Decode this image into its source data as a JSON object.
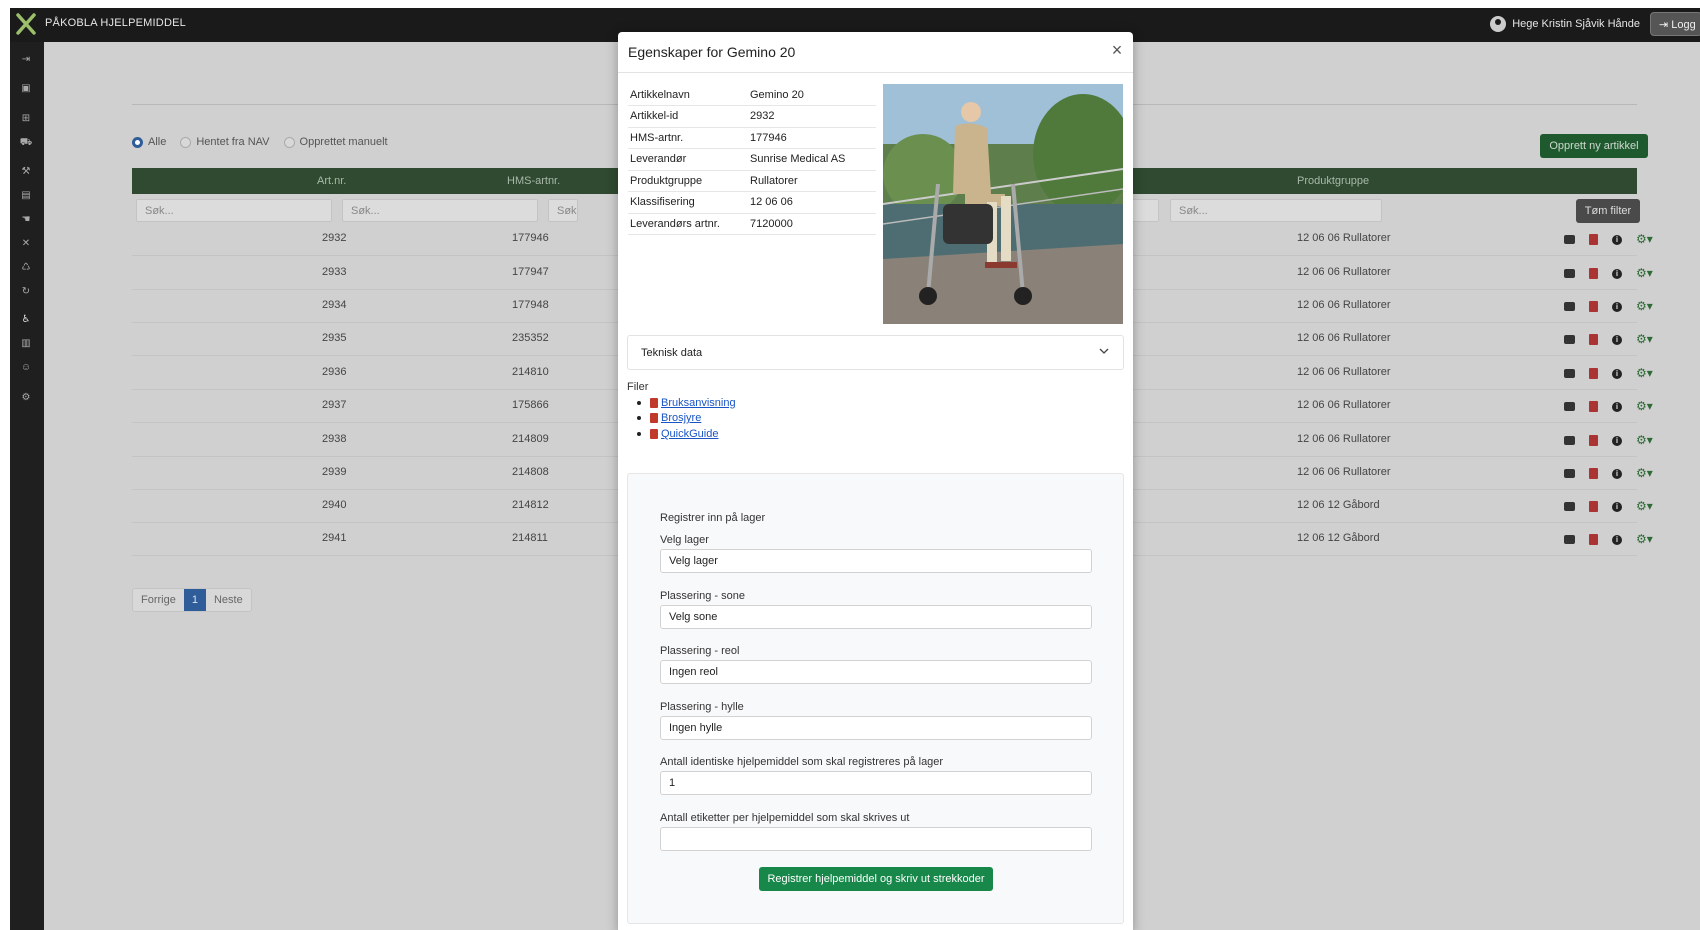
{
  "app": {
    "title": "PÅKOBLA HJELPEMIDDEL"
  },
  "user": {
    "name": "Hege Kristin Sjåvik Hånde",
    "logout_label": "Logg"
  },
  "filters": {
    "radio_options": [
      "Alle",
      "Hentet fra NAV",
      "Opprettet manuelt"
    ],
    "selected": "Alle",
    "search_placeholder": "Søk...",
    "partial_placeholder": "Søk",
    "clear_label": "Tøm filter"
  },
  "new_article_label": "Opprett ny artikkel",
  "table": {
    "headers": {
      "art_nr": "Art.nr.",
      "hms_artnr": "HMS-artnr.",
      "produktgruppe": "Produktgruppe"
    },
    "rows": [
      {
        "art_nr": "2932",
        "hms": "177946",
        "group": "12 06 06 Rullatorer"
      },
      {
        "art_nr": "2933",
        "hms": "177947",
        "group": "12 06 06 Rullatorer"
      },
      {
        "art_nr": "2934",
        "hms": "177948",
        "group": "12 06 06 Rullatorer"
      },
      {
        "art_nr": "2935",
        "hms": "235352",
        "group": "12 06 06 Rullatorer"
      },
      {
        "art_nr": "2936",
        "hms": "214810",
        "group": "12 06 06 Rullatorer"
      },
      {
        "art_nr": "2937",
        "hms": "175866",
        "group": "12 06 06 Rullatorer"
      },
      {
        "art_nr": "2938",
        "hms": "214809",
        "group": "12 06 06 Rullatorer"
      },
      {
        "art_nr": "2939",
        "hms": "214808",
        "group": "12 06 06 Rullatorer"
      },
      {
        "art_nr": "2940",
        "hms": "214812",
        "group": "12 06 12 Gåbord"
      },
      {
        "art_nr": "2941",
        "hms": "214811",
        "group": "12 06 12 Gåbord"
      }
    ]
  },
  "pager": {
    "prev": "Forrige",
    "current": "1",
    "next": "Neste"
  },
  "modal": {
    "title": "Egenskaper for Gemino 20",
    "close_symbol": "×",
    "props": [
      {
        "k": "Artikkelnavn",
        "v": "Gemino 20"
      },
      {
        "k": "Artikkel-id",
        "v": "2932"
      },
      {
        "k": "HMS-artnr.",
        "v": "177946"
      },
      {
        "k": "Leverandør",
        "v": "Sunrise Medical AS"
      },
      {
        "k": "Produktgruppe",
        "v": "Rullatorer"
      },
      {
        "k": "Klassifisering",
        "v": "12 06 06"
      },
      {
        "k": "Leverandørs artnr.",
        "v": "7120000"
      }
    ],
    "teknisk_label": "Teknisk data",
    "files_label": "Filer",
    "files": [
      "Bruksanvisning",
      "Brosjyre",
      "QuickGuide"
    ],
    "register": {
      "title": "Registrer inn på lager",
      "fields": [
        {
          "label": "Velg lager",
          "value": "Velg lager"
        },
        {
          "label": "Plassering - sone",
          "value": "Velg sone"
        },
        {
          "label": "Plassering - reol",
          "value": "Ingen reol"
        },
        {
          "label": "Plassering - hylle",
          "value": "Ingen hylle"
        },
        {
          "label": "Antall identiske hjelpemiddel som skal registreres på lager",
          "value": "1"
        },
        {
          "label": "Antall etiketter per hjelpemiddel som skal skrives ut",
          "value": ""
        }
      ],
      "submit_label": "Registrer hjelpemiddel og skriv ut strekkoder"
    }
  },
  "colors": {
    "header_green": "#2f4a30",
    "accent_blue": "#2e5d9a",
    "submit_green": "#17874a",
    "link_blue": "#1a55c4"
  }
}
